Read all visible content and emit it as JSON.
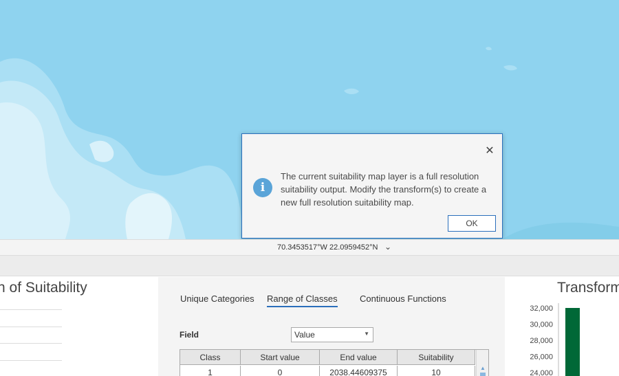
{
  "map": {
    "water_color": "#8fd3ef",
    "land_color": "#bfe6f6"
  },
  "dialog": {
    "close_glyph": "✕",
    "info_glyph": "i",
    "message": "The current suitability map layer is a full resolution suitability output. Modify the transform(s) to create a new full resolution suitability map.",
    "ok_label": "OK"
  },
  "status": {
    "coordinates": "70.3453517°W 22.0959452°N",
    "chevron": "⌄"
  },
  "left_panel": {
    "title": "n of Suitability"
  },
  "center_panel": {
    "tabs": [
      {
        "label": "Unique Categories",
        "active": false
      },
      {
        "label": "Range of Classes",
        "active": true
      },
      {
        "label": "Continuous Functions",
        "active": false
      }
    ],
    "field_label": "Field",
    "field_value": "Value",
    "table": {
      "columns": [
        "Class",
        "Start value",
        "End value",
        "Suitability"
      ],
      "rows": [
        [
          "1",
          "0",
          "2038.44609375",
          "10"
        ]
      ]
    }
  },
  "right_panel": {
    "title": "Transform",
    "chart_data": {
      "type": "bar",
      "title": "Transform",
      "y_ticks": [
        "32,000",
        "30,000",
        "28,000",
        "26,000",
        "24,000"
      ],
      "ylim": [
        24000,
        32000
      ],
      "series": [
        {
          "values": [
            32000
          ],
          "color": "#006837"
        }
      ]
    }
  }
}
